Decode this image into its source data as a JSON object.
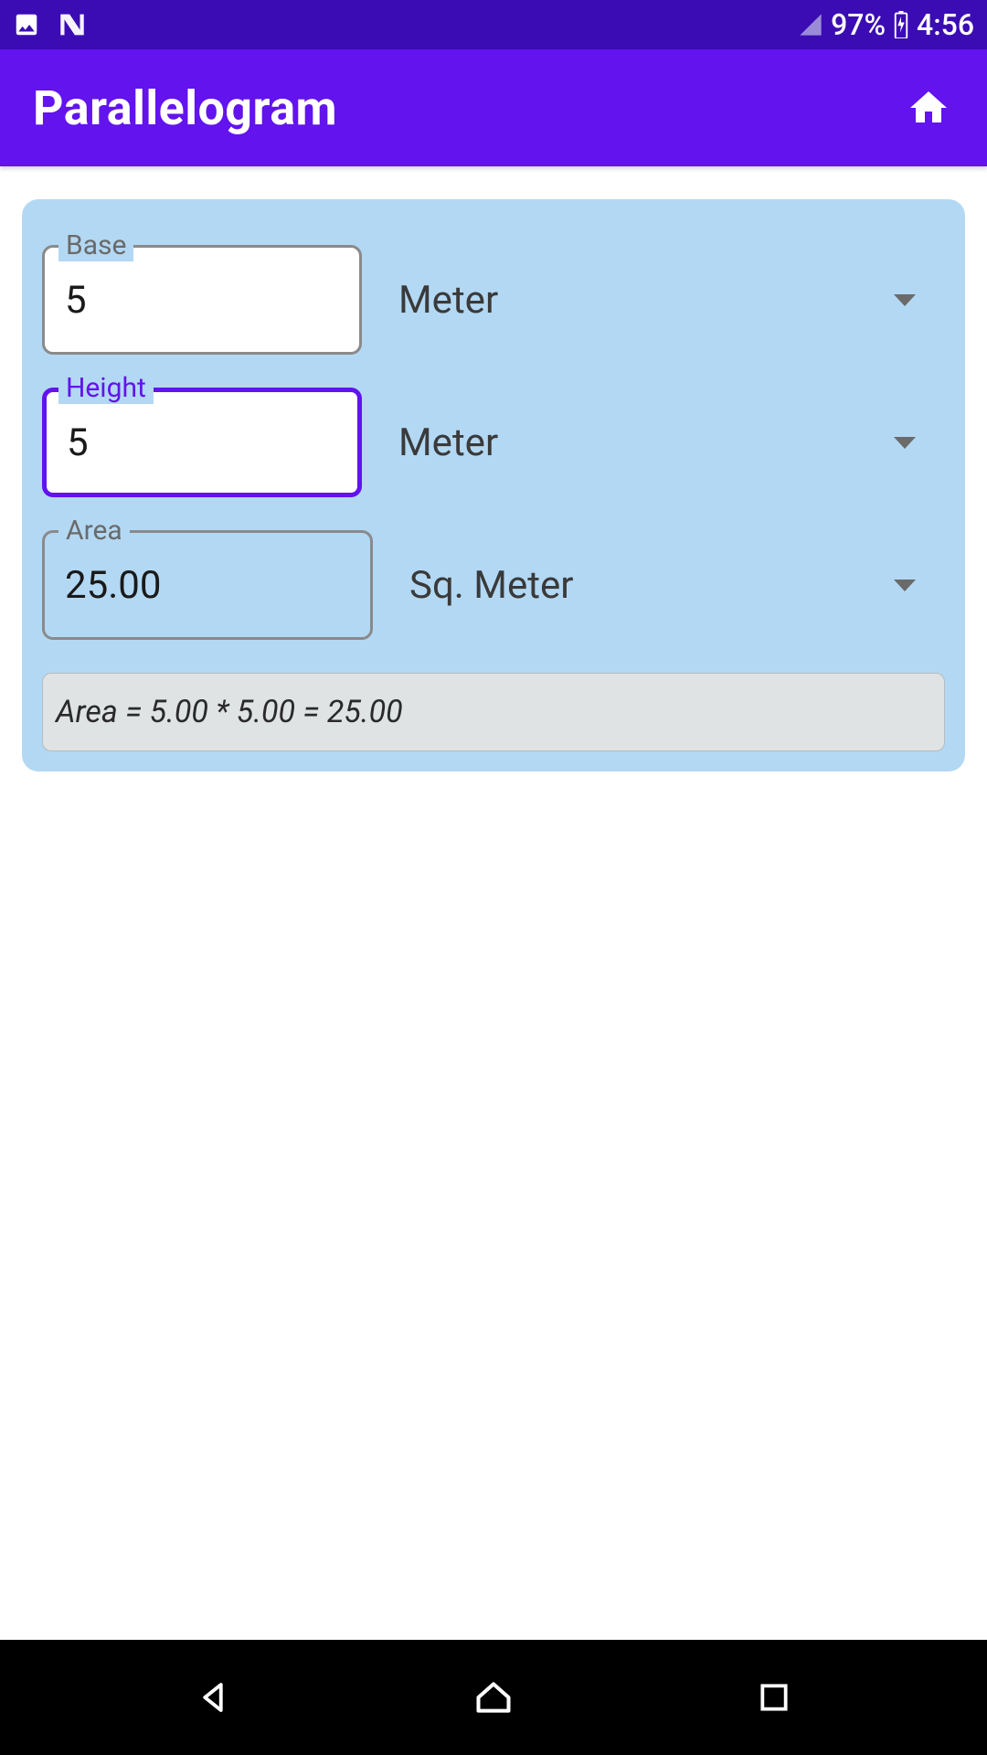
{
  "statusBar": {
    "battery": "97%",
    "time": "4:56"
  },
  "appBar": {
    "title": "Parallelogram"
  },
  "fields": {
    "base": {
      "label": "Base",
      "value": "5",
      "unit": "Meter"
    },
    "height": {
      "label": "Height",
      "value": "5",
      "unit": "Meter"
    },
    "area": {
      "label": "Area",
      "value": "25.00",
      "unit": "Sq. Meter"
    }
  },
  "formula": "Area = 5.00 * 5.00 = 25.00"
}
